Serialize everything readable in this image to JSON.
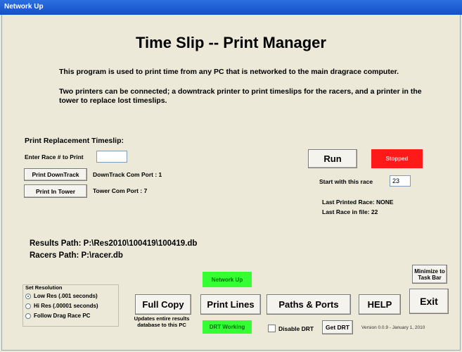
{
  "window": {
    "title": "Network Up"
  },
  "main": {
    "title": "Time Slip -- Print Manager",
    "description1": "This program is used to print time from any PC that is networked to the main dragrace computer.",
    "description2": "Two printers can be connected;  a downtrack printer to print timeslips for the racers, and a printer in the tower to replace lost timeslips."
  },
  "replacement": {
    "heading": "Print Replacement Timeslip:",
    "race_label": "Enter Race # to Print",
    "race_value": "",
    "print_downtrack_label": "Print DownTrack",
    "downtrack_port": "DownTrack Com Port : 1",
    "print_tower_label": "Print In Tower",
    "tower_port": "Tower Com Port : 7"
  },
  "run_panel": {
    "run_label": "Run",
    "status": "Stopped",
    "status_color": "#ff1a1a",
    "start_label": "Start with this race",
    "start_value": "23",
    "last_printed": "Last Printed Race: NONE",
    "last_in_file": "Last Race in file: 22"
  },
  "paths": {
    "results": "Results Path:  P:\\Res2010\\100419\\100419.db",
    "racers": "Racers Path:  P:\\racer.db"
  },
  "resolution": {
    "title": "Set Resolution",
    "options": [
      {
        "label": "Low Res (.001 seconds)",
        "selected": true
      },
      {
        "label": "Hi Res (.00001 seconds)",
        "selected": false
      },
      {
        "label": "Follow Drag Race PC",
        "selected": false
      }
    ]
  },
  "toolbar": {
    "full_copy": "Full Copy",
    "full_copy_note": "Updates entire results database to this PC",
    "print_lines": "Print Lines",
    "paths_ports": "Paths & Ports",
    "help": "HELP",
    "exit": "Exit",
    "minimize": "Minimize to Task Bar",
    "network_status": "Network Up",
    "drt_status": "DRT Working",
    "status_green": "#33ff33",
    "disable_drt": "Disable DRT",
    "get_drt": "Get DRT",
    "version": "Version 0.0.9 - January 1, 2010"
  }
}
